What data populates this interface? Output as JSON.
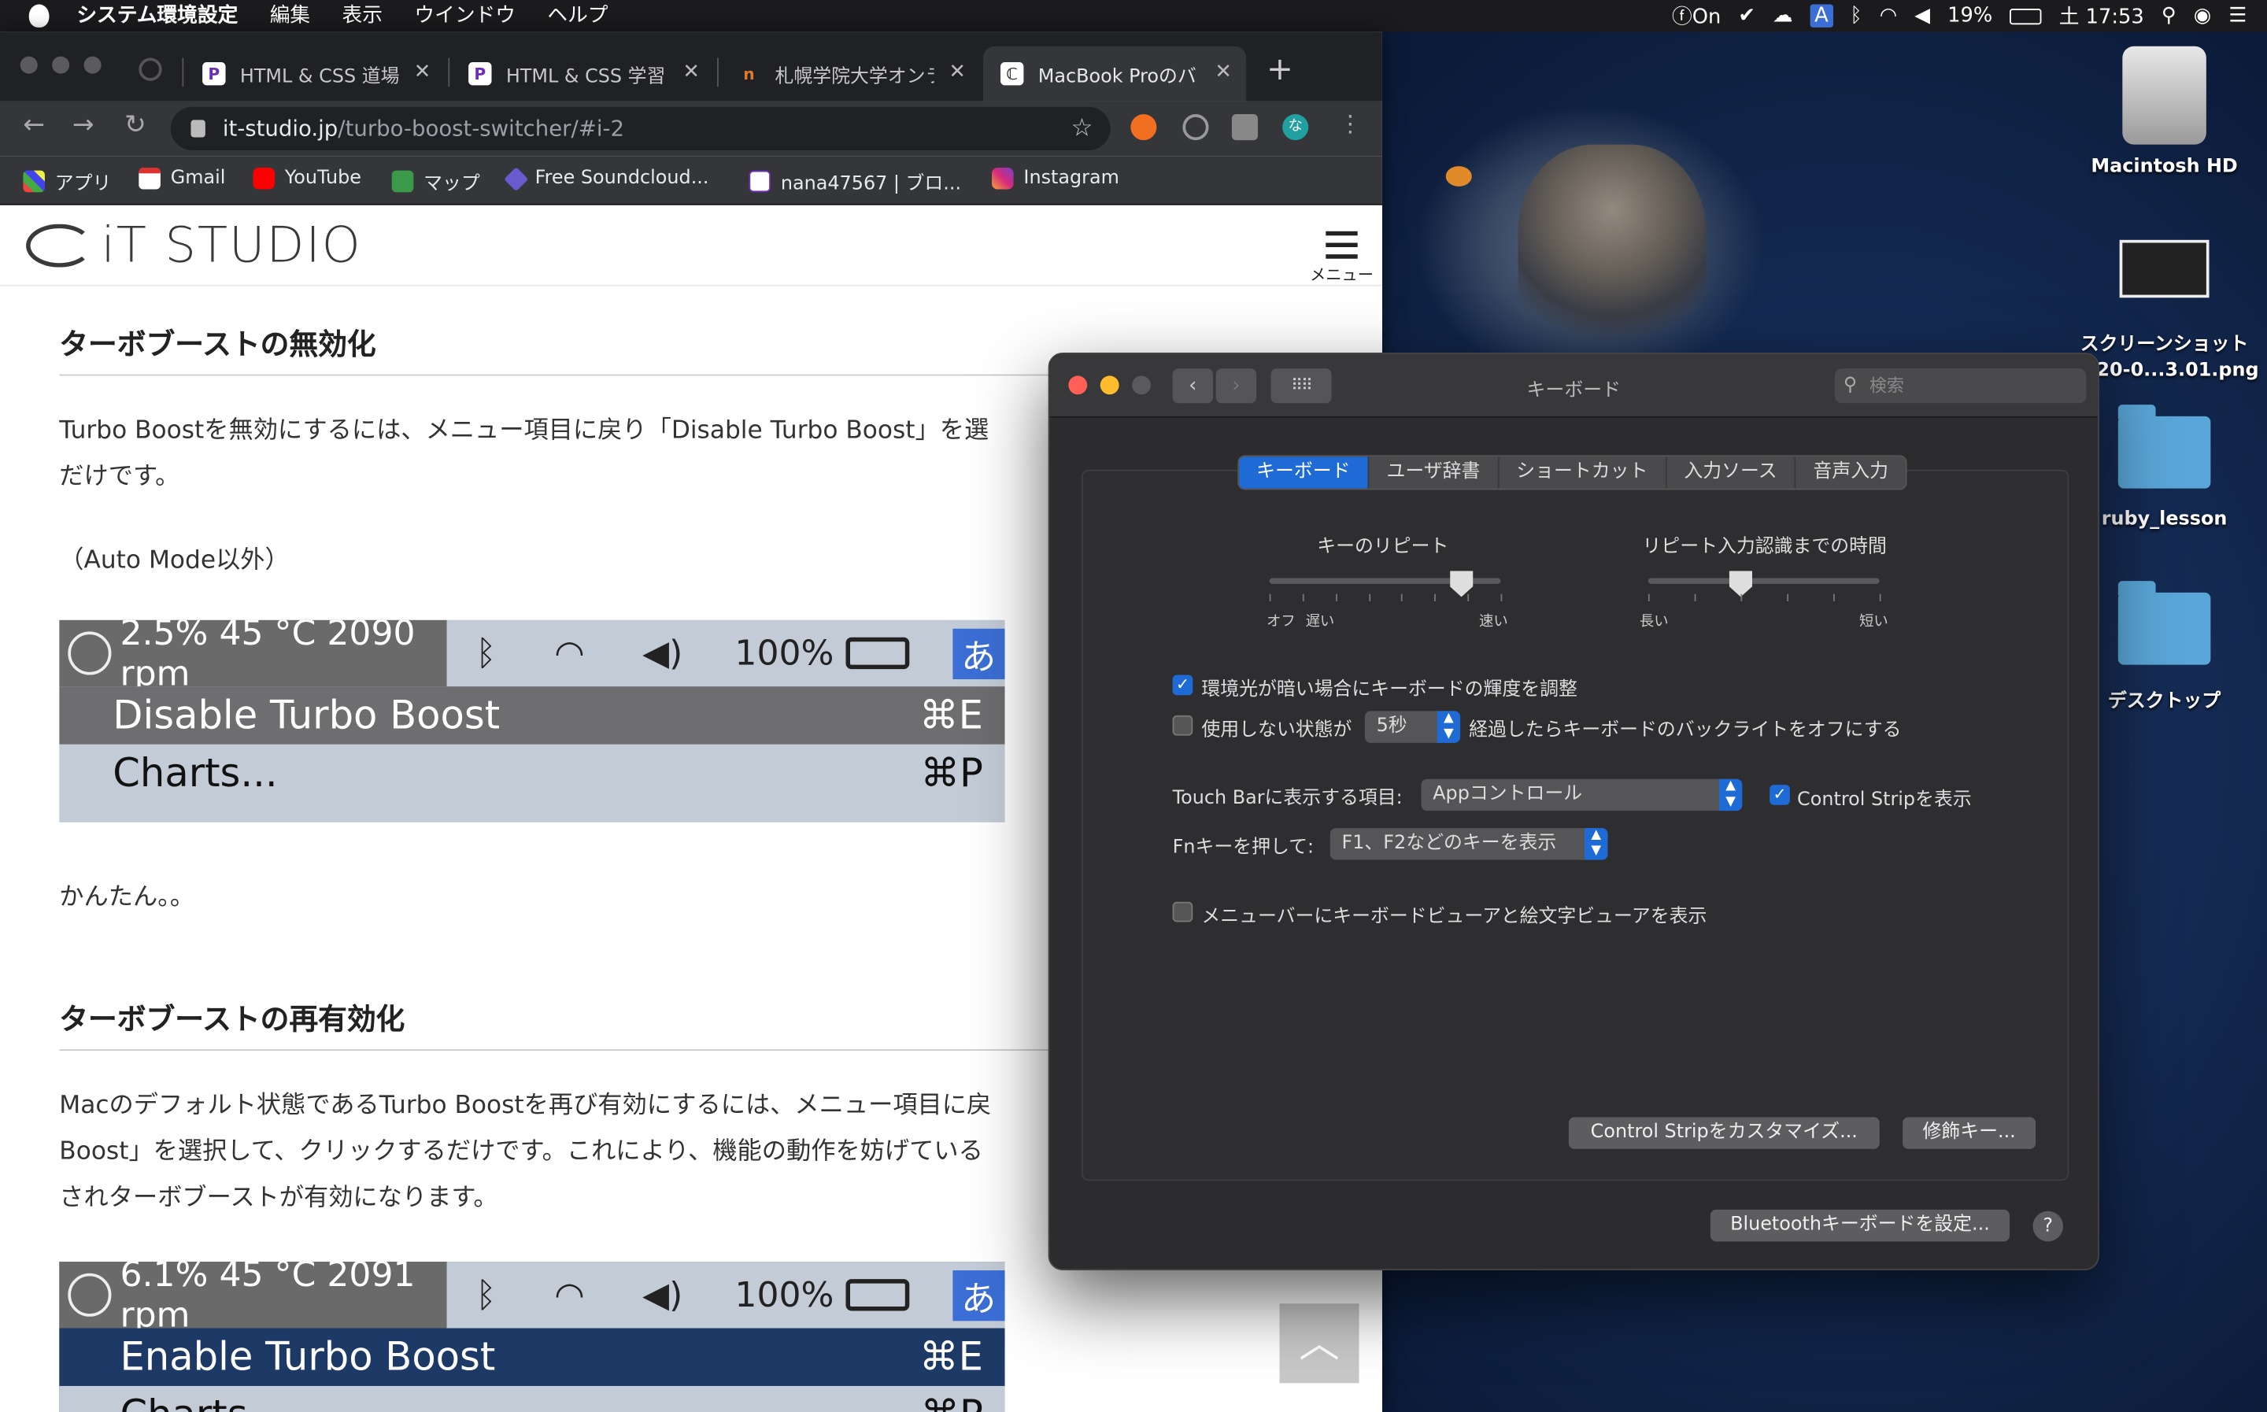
{
  "menubar": {
    "app": "システム環境設定",
    "items": [
      "編集",
      "表示",
      "ウインドウ",
      "ヘルプ"
    ],
    "status_on": "On",
    "input_mode": "A",
    "battery": "19%",
    "clock": "土 17:53"
  },
  "desktop": {
    "icons": [
      {
        "label": "Macintosh HD"
      },
      {
        "label": "スクリーンショット\n2020-0...3.01.png"
      },
      {
        "label": "ruby_lesson"
      },
      {
        "label": "デスクトップ"
      }
    ]
  },
  "browser": {
    "tabs": [
      {
        "title": "HTML & CSS 道場",
        "fav": "P"
      },
      {
        "title": "HTML & CSS 学習",
        "fav": "P"
      },
      {
        "title": "札幌学院大学オンラ",
        "fav": "n"
      },
      {
        "title": "MacBook Proのバ",
        "fav": "ℂ"
      }
    ],
    "url_host": "it-studio.jp",
    "url_path": "/turbo-boost-switcher/#i-2",
    "bookmarks": [
      "アプリ",
      "Gmail",
      "YouTube",
      "マップ",
      "Free Soundcloud...",
      "nana47567 | ブロ...",
      "Instagram"
    ],
    "profile_initial": "な"
  },
  "site": {
    "logo": "iT STUDIO",
    "menu_label": "メニュー"
  },
  "article": {
    "h1": "ターボブーストの無効化",
    "p1a": "Turbo Boostを無効にするには、メニュー項目に戻り「Disable Turbo Boost」を選",
    "p1b": "だけです。",
    "p2": "（Auto Mode以外）",
    "shot1": {
      "status": "2.5% 45 °C 2090 rpm",
      "pct": "100%",
      "ime": "あ",
      "item1": "Disable Turbo Boost",
      "key1": "⌘E",
      "item2": "Charts...",
      "key2": "⌘P"
    },
    "p3": "かんたん。。",
    "h2": "ターボブーストの再有効化",
    "p4a": "Macのデフォルト状態であるTurbo Boostを再び有効にするには、メニュー項目に戻",
    "p4b": "Boost」を選択して、クリックするだけです。これにより、機能の動作を妨げている",
    "p4c": "されターボブーストが有効になります。",
    "shot2": {
      "status": "6.1% 45 °C 2091 rpm",
      "pct": "100%",
      "ime": "あ",
      "item1": "Enable Turbo Boost",
      "key1": "⌘E",
      "item2": "Charts...",
      "key2": "⌘P"
    }
  },
  "prefs": {
    "title": "キーボード",
    "search_placeholder": "検索",
    "tabs": [
      "キーボード",
      "ユーザ辞書",
      "ショートカット",
      "入力ソース",
      "音声入力"
    ],
    "key_repeat_label": "キーのリピート",
    "repeat_left": "オフ",
    "repeat_slow": "遅い",
    "repeat_fast": "速い",
    "delay_label": "リピート入力認識までの時間",
    "delay_long": "長い",
    "delay_short": "短い",
    "key_repeat_level": 0.83,
    "delay_level": 0.4,
    "chk1": "環境光が暗い場合にキーボードの輝度を調整",
    "chk1_checked": true,
    "chk2a": "使用しない状態が",
    "chk2_value": "5秒",
    "chk2b": "経過したらキーボードのバックライトをオフにする",
    "chk2_checked": false,
    "touchbar_label": "Touch Barに表示する項目:",
    "touchbar_value": "Appコントロール",
    "control_strip": "Control Stripを表示",
    "control_strip_checked": true,
    "fn_label": "Fnキーを押して:",
    "fn_value": "F1、F2などのキーを表示",
    "chk3": "メニューバーにキーボードビューアと絵文字ビューアを表示",
    "chk3_checked": false,
    "btn_customize": "Control Stripをカスタマイズ...",
    "btn_modifier": "修飾キー...",
    "btn_bluetooth": "Bluetoothキーボードを設定...",
    "help": "?"
  }
}
